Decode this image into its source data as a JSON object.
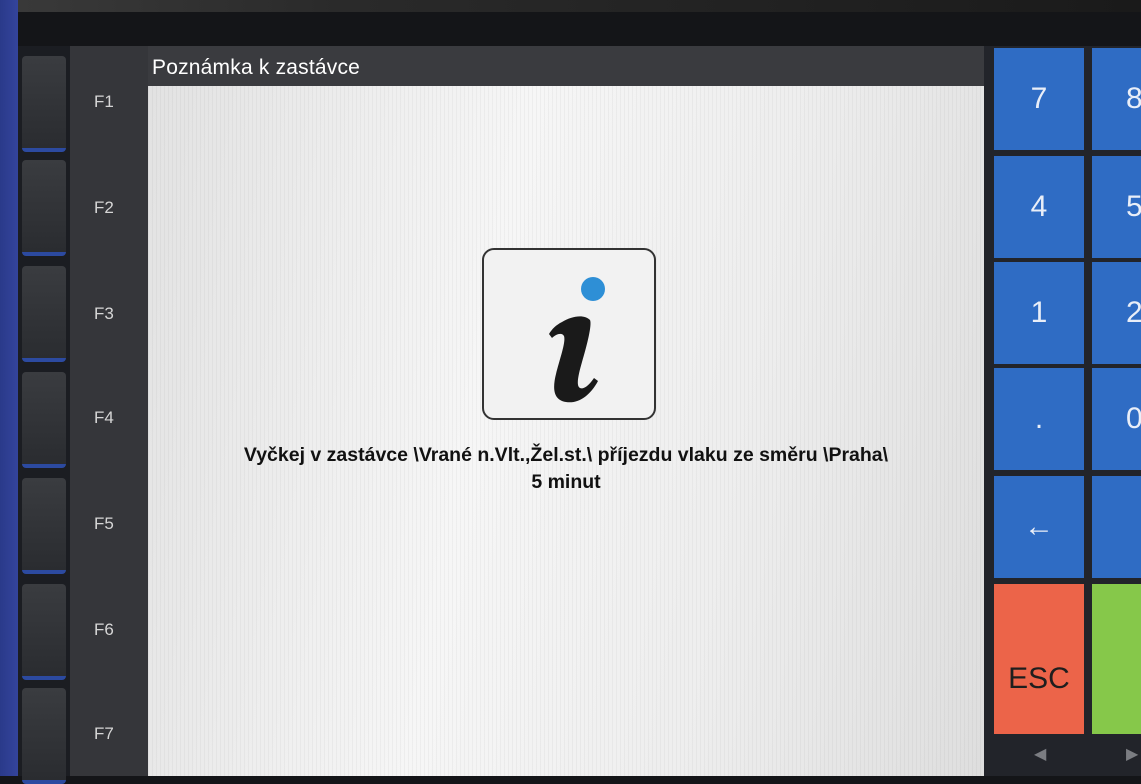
{
  "dialog": {
    "title": "Poznámka k zastávce",
    "message_line1": "Vyčkej v zastávce \\Vrané n.Vlt.,Žel.st.\\ příjezdu vlaku ze směru \\Praha\\",
    "message_line2": "5 minut",
    "icon": "info-icon"
  },
  "function_keys": [
    "F1",
    "F2",
    "F3",
    "F4",
    "F5",
    "F6",
    "F7"
  ],
  "keypad": {
    "rows": [
      [
        "7",
        "8"
      ],
      [
        "4",
        "5"
      ],
      [
        "1",
        "2"
      ],
      [
        ".",
        "0"
      ],
      [
        "←",
        ""
      ]
    ],
    "esc_label": "ESC",
    "ok_label": "",
    "nav_left": "◀",
    "nav_right": "▶"
  },
  "colors": {
    "key_blue": "#2f6cc4",
    "esc_red": "#ec6449",
    "ok_green": "#86c84a",
    "info_dot": "#2e8fd6"
  }
}
